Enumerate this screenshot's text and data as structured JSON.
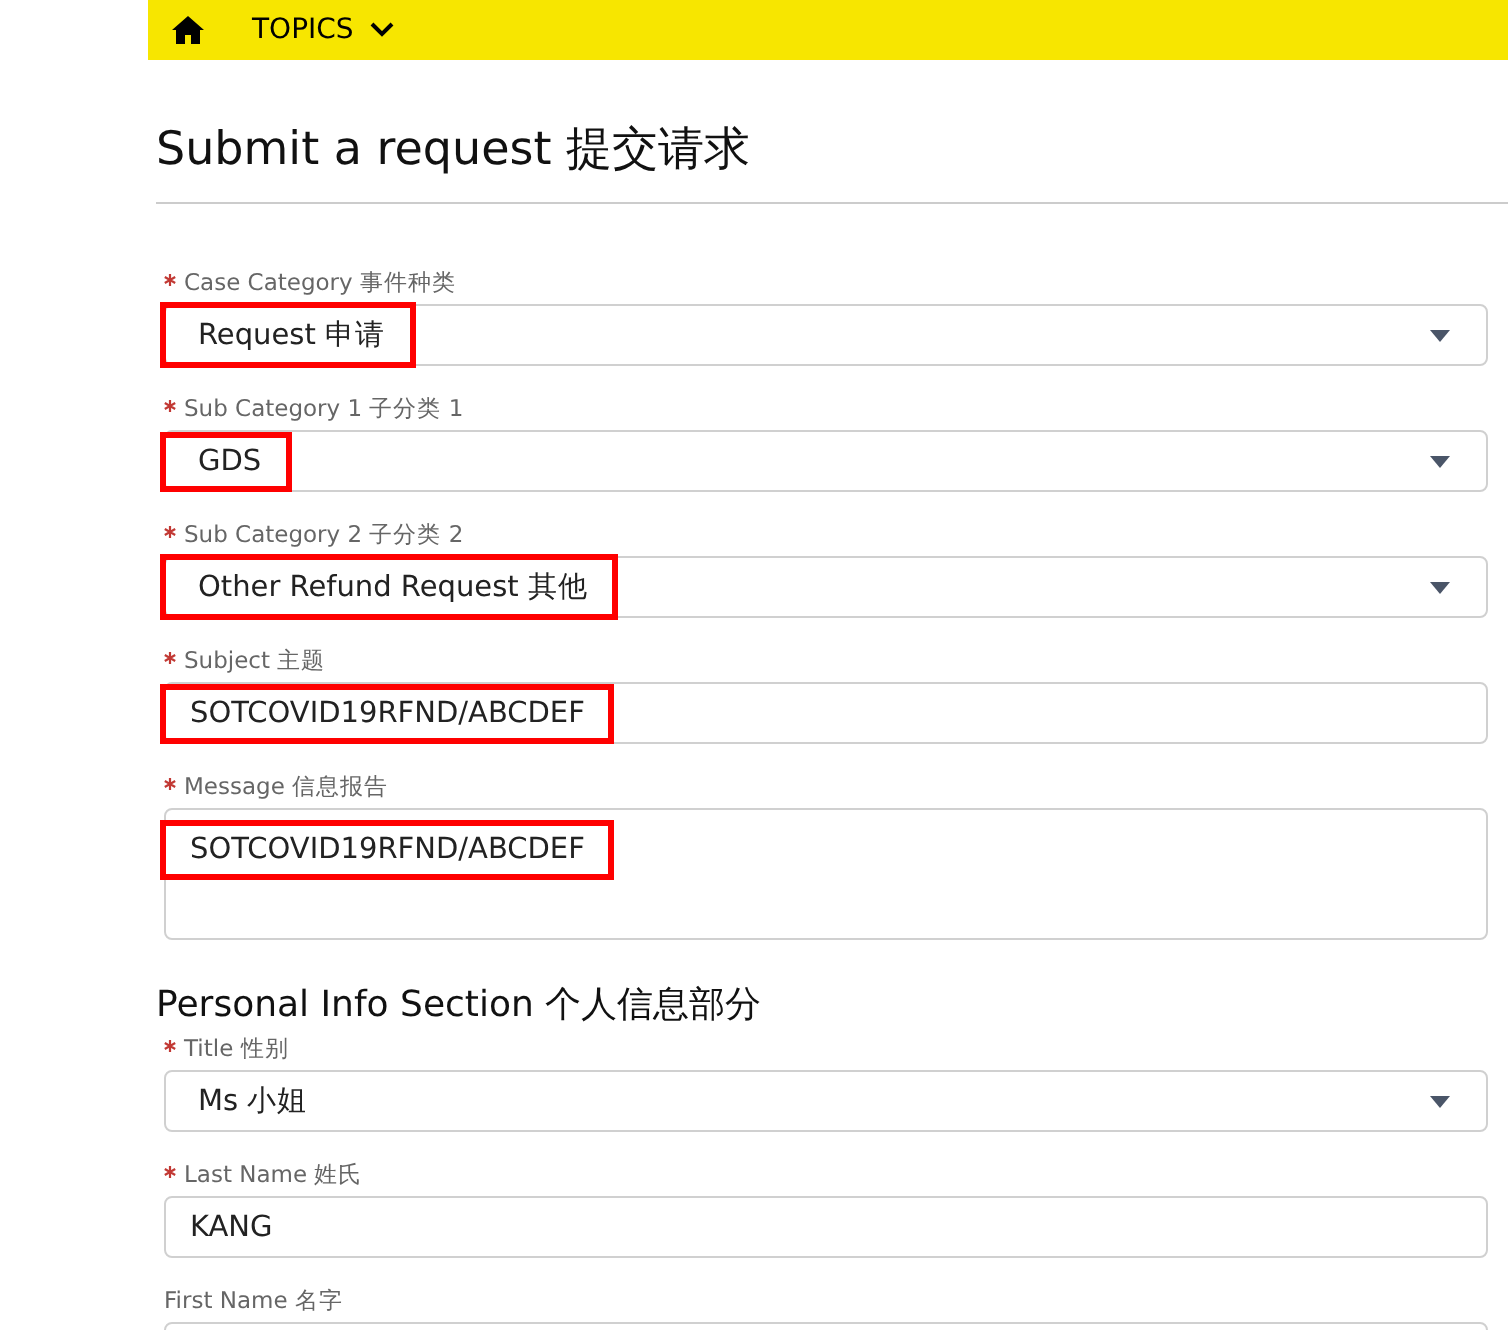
{
  "nav": {
    "topics_label": "TOPICS"
  },
  "title": "Submit a request 提交请求",
  "fields": [
    {
      "kind": "select",
      "label": "Case Category 事件种类",
      "required": true,
      "value": "Request 申请",
      "highlighted": true
    },
    {
      "kind": "select",
      "label": "Sub Category 1 子分类 1",
      "required": true,
      "value": "GDS",
      "highlighted": true
    },
    {
      "kind": "select",
      "label": "Sub Category 2 子分类 2",
      "required": true,
      "value": "Other Refund Request 其他",
      "highlighted": true
    },
    {
      "kind": "input",
      "label": "Subject 主题",
      "required": true,
      "value": "SOTCOVID19RFND/ABCDEF",
      "highlighted": true
    },
    {
      "kind": "textarea",
      "label": "Message 信息报告",
      "required": true,
      "value": "SOTCOVID19RFND/ABCDEF",
      "highlighted": true
    }
  ],
  "section_title": "Personal Info Section 个人信息部分",
  "personal_fields": [
    {
      "kind": "select",
      "label": "Title 性别",
      "required": true,
      "value": "Ms 小姐"
    },
    {
      "kind": "input",
      "label": "Last Name 姓氏",
      "required": true,
      "value": "KANG"
    },
    {
      "kind": "input",
      "label": "First Name 名字",
      "required": false
    }
  ]
}
